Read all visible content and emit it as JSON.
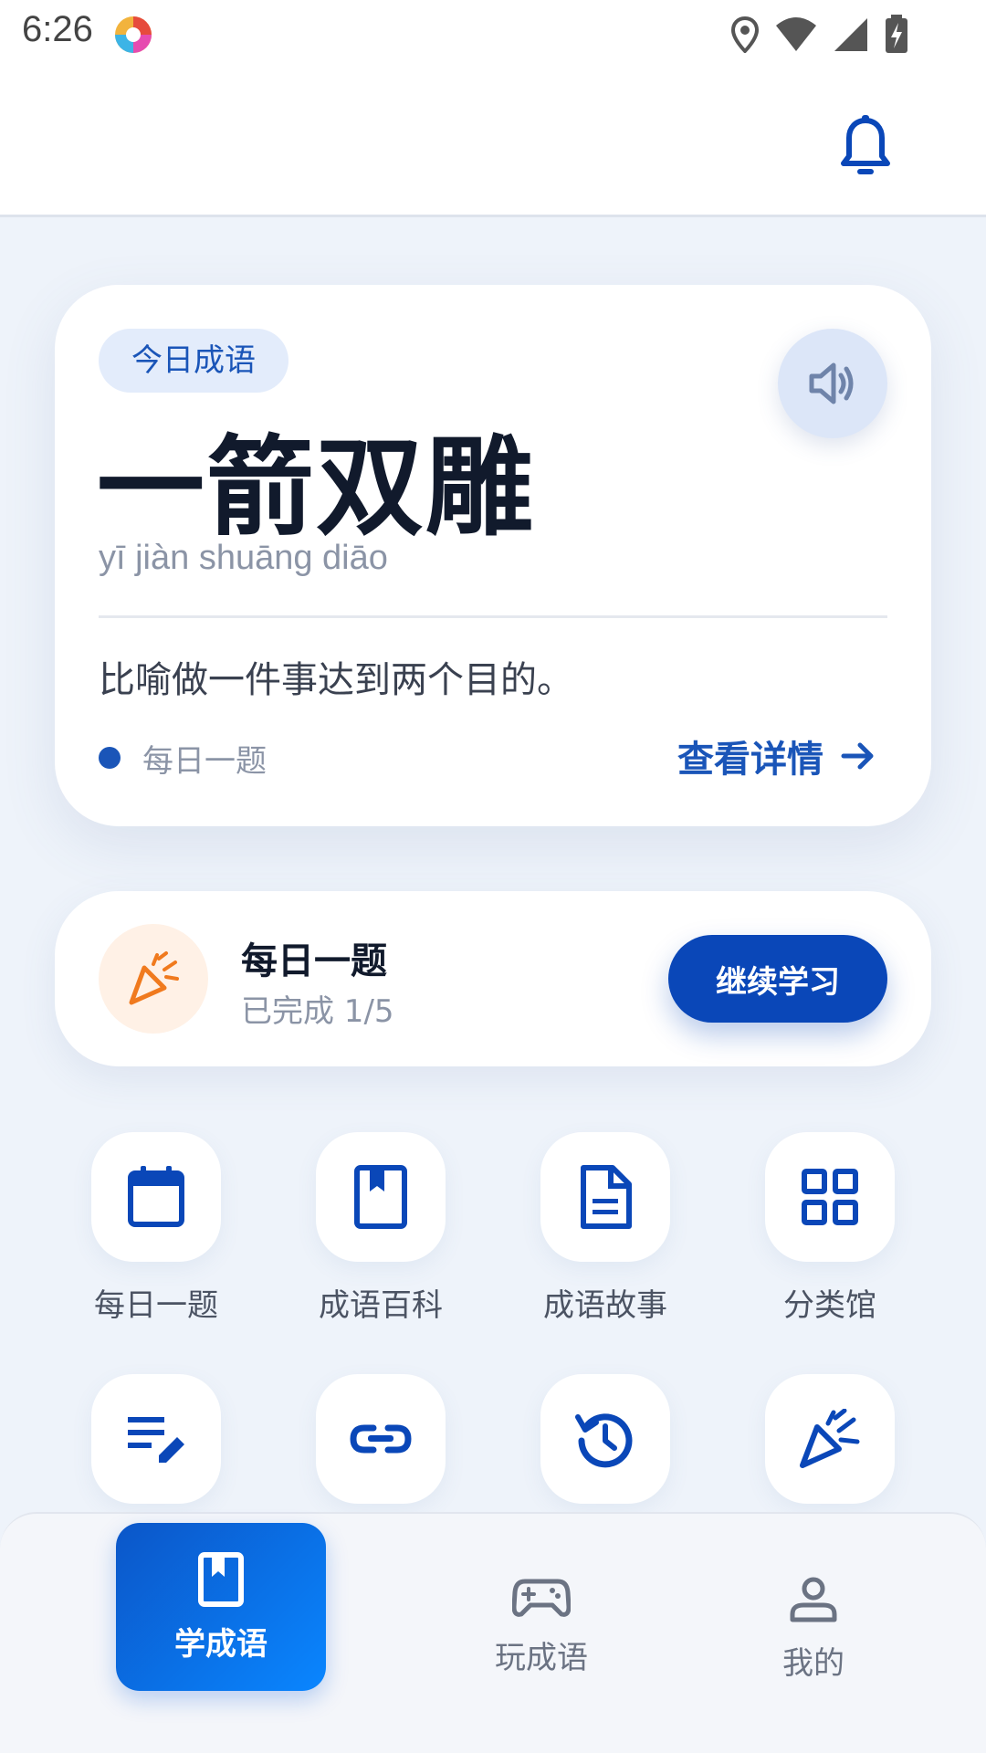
{
  "status_bar": {
    "time": "6:26"
  },
  "today_card": {
    "tag": "今日成语",
    "idiom": "一箭双雕",
    "pinyin": "yī jiàn shuāng diāo",
    "meaning": "比喻做一件事达到两个目的。",
    "footer_label": "每日一题",
    "details_link": "查看详情"
  },
  "daily_task": {
    "title": "每日一题",
    "progress": "已完成 1/5",
    "button": "继续学习"
  },
  "features": [
    {
      "label": "每日一题",
      "icon": "calendar-icon"
    },
    {
      "label": "成语百科",
      "icon": "book-icon"
    },
    {
      "label": "成语故事",
      "icon": "document-icon"
    },
    {
      "label": "分类馆",
      "icon": "grid-icon"
    },
    {
      "label": "",
      "icon": "edit-list-icon"
    },
    {
      "label": "",
      "icon": "link-icon"
    },
    {
      "label": "",
      "icon": "history-icon"
    },
    {
      "label": "",
      "icon": "party-popper-icon"
    }
  ],
  "bottom_nav": [
    {
      "label": "学成语",
      "icon": "book-icon",
      "active": true
    },
    {
      "label": "玩成语",
      "icon": "gamepad-icon",
      "active": false
    },
    {
      "label": "我的",
      "icon": "person-icon",
      "active": false
    }
  ],
  "colors": {
    "primary": "#0A47B8",
    "accent_orange": "#F07A1E",
    "background": "#EEF3FA"
  }
}
